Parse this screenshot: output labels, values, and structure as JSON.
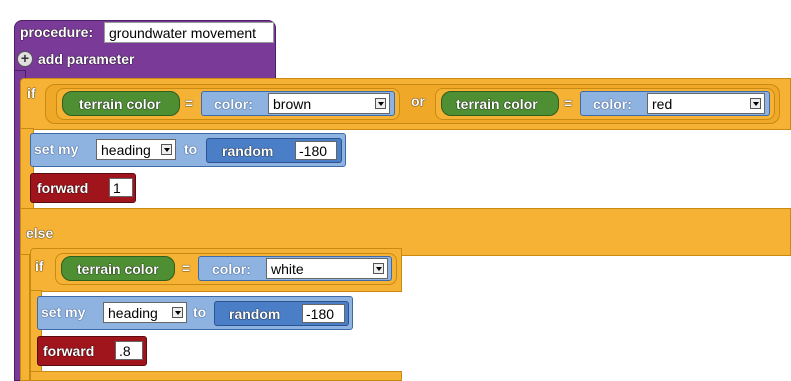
{
  "procedure": {
    "keyword": "procedure:",
    "name": "groundwater movement",
    "add_parameter": "add parameter"
  },
  "if_block_1": {
    "if_label": "if",
    "or_label": "or",
    "cond_a": {
      "reporter": "terrain color",
      "eq": "=",
      "color_label": "color:",
      "color_value": "brown"
    },
    "cond_b": {
      "reporter": "terrain color",
      "eq": "=",
      "color_label": "color:",
      "color_value": "red"
    },
    "set": {
      "set_label": "set my",
      "var": "heading",
      "to_label": "to",
      "random_label": "random",
      "random_value": "-180"
    },
    "forward": {
      "label": "forward",
      "value": "1"
    },
    "else_label": "else"
  },
  "if_block_2": {
    "if_label": "if",
    "cond": {
      "reporter": "terrain color",
      "eq": "=",
      "color_label": "color:",
      "color_value": "white"
    },
    "set": {
      "set_label": "set my",
      "var": "heading",
      "to_label": "to",
      "random_label": "random",
      "random_value": "-180"
    },
    "forward": {
      "label": "forward",
      "value": ".8"
    }
  },
  "colors": {
    "procedure": "#7a3a98",
    "control": "#f6b234",
    "reporter": "#4f8f34",
    "color_block": "#8fb3e0",
    "action": "#4a7ec6",
    "motion": "#a0141b"
  }
}
